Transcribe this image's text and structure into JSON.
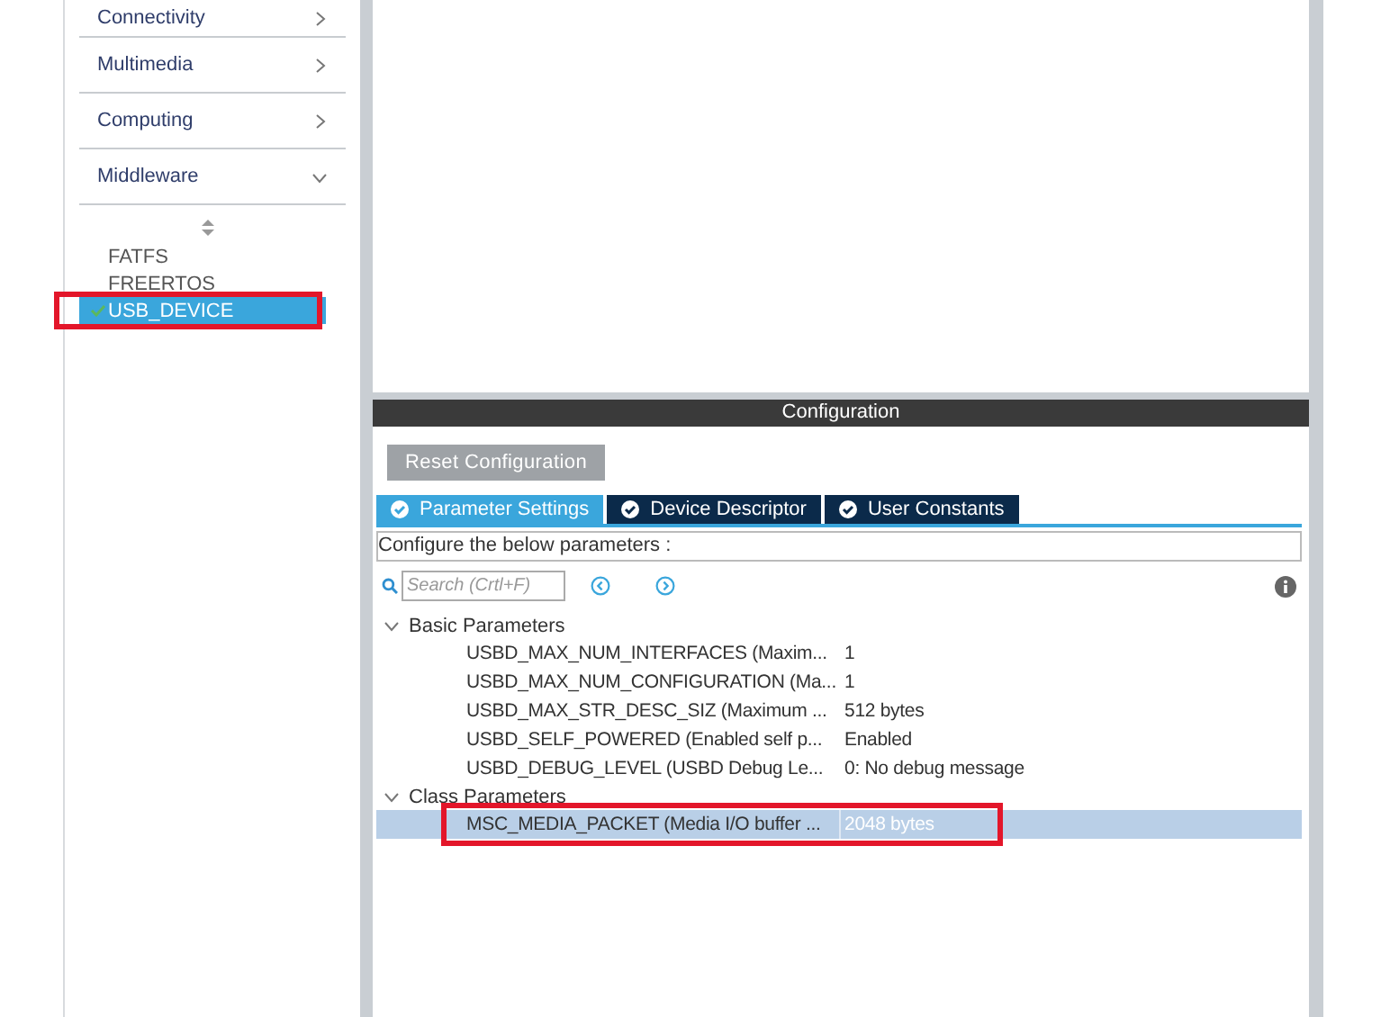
{
  "sidebar": {
    "categories": [
      {
        "label": "Connectivity",
        "expanded": false
      },
      {
        "label": "Multimedia",
        "expanded": false
      },
      {
        "label": "Computing",
        "expanded": false
      },
      {
        "label": "Middleware",
        "expanded": true
      }
    ],
    "middleware_items": [
      {
        "label": "FATFS",
        "enabled": false,
        "selected": false,
        "highlighted": false
      },
      {
        "label": "FREERTOS",
        "enabled": false,
        "selected": false,
        "highlighted": false
      },
      {
        "label": "USB_DEVICE",
        "enabled": true,
        "selected": true,
        "highlighted": true
      }
    ]
  },
  "configuration": {
    "title": "Configuration",
    "reset_button": "Reset Configuration",
    "tabs": [
      {
        "label": "Parameter Settings",
        "selected": true
      },
      {
        "label": "Device Descriptor",
        "selected": false
      },
      {
        "label": "User Constants",
        "selected": false
      }
    ],
    "description": "Configure the below parameters :",
    "search": {
      "placeholder": "Search (Crtl+F)"
    },
    "groups": [
      {
        "label": "Basic Parameters",
        "expanded": true,
        "rows": [
          {
            "name": "USBD_MAX_NUM_INTERFACES (Maxim...",
            "value": "1",
            "selected": false,
            "highlighted": false
          },
          {
            "name": "USBD_MAX_NUM_CONFIGURATION (Ma...",
            "value": "1",
            "selected": false,
            "highlighted": false
          },
          {
            "name": "USBD_MAX_STR_DESC_SIZ (Maximum ...",
            "value": "512 bytes",
            "selected": false,
            "highlighted": false
          },
          {
            "name": "USBD_SELF_POWERED (Enabled self p...",
            "value": "Enabled",
            "selected": false,
            "highlighted": false
          },
          {
            "name": "USBD_DEBUG_LEVEL (USBD Debug Le...",
            "value": "0: No debug message",
            "selected": false,
            "highlighted": false
          }
        ]
      },
      {
        "label": "Class Parameters",
        "expanded": true,
        "rows": [
          {
            "name": "MSC_MEDIA_PACKET (Media I/O buffer ...",
            "value": "2048 bytes",
            "selected": true,
            "highlighted": true
          }
        ]
      }
    ]
  }
}
